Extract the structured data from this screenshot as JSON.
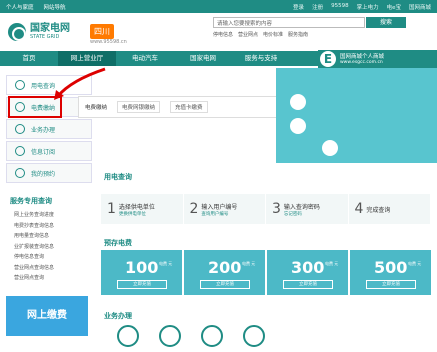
{
  "topbar": {
    "links": [
      "个人与家庭",
      "网站导航"
    ],
    "right": [
      "登录",
      "注册",
      "95598",
      "掌上电力",
      "电e宝",
      "国网商城",
      "95598"
    ]
  },
  "header": {
    "logo_cn": "国家电网",
    "logo_en": "STATE GRID",
    "province": "四川",
    "province_url": "www.95598.cn"
  },
  "search": {
    "placeholder": "请输入您要搜索的内容",
    "button": "搜索",
    "hot": [
      "停电信息",
      "营业网点",
      "电价标准",
      "服务指南"
    ]
  },
  "nav": {
    "items": [
      "首页",
      "网上营业厅",
      "电动汽车",
      "国家电网",
      "服务与支持"
    ],
    "active": 1
  },
  "mall": {
    "title": "国网商城个人商城",
    "url": "www.esgcc.com.cn"
  },
  "sidebar": {
    "items": [
      "用电查询",
      "电费缴纳",
      "业务办理",
      "信息订阅",
      "我的预约"
    ]
  },
  "popup": {
    "label": "电费缴纳",
    "options": [
      "电费网银缴纳",
      "充值卡缴费"
    ]
  },
  "query": {
    "title": "用电查询",
    "steps": [
      {
        "n": "1",
        "t": "选择供电单位",
        "s": "更换供电单位"
      },
      {
        "n": "2",
        "t": "输入用户编号",
        "s": "查询用户编号"
      },
      {
        "n": "3",
        "t": "输入查询密码",
        "s": "忘记密码"
      },
      {
        "n": "4",
        "t": "完成查询",
        "s": ""
      }
    ]
  },
  "prepay": {
    "title": "预存电费",
    "items": [
      {
        "amt": "100",
        "btn": "立即充值"
      },
      {
        "amt": "200",
        "btn": "立即充值"
      },
      {
        "amt": "300",
        "btn": "立即充值"
      },
      {
        "amt": "500",
        "btn": "立即充值"
      }
    ],
    "unit": "电费 元"
  },
  "biz": {
    "title": "业务办理"
  },
  "side2": {
    "title": "服务专用查询",
    "items": [
      "网上业务查询进度",
      "电费抄表查询信息",
      "用电量查询信息",
      "业扩报装查询信息",
      "停电信息查询",
      "营业网点查询信息",
      "营业网点查询"
    ]
  },
  "pay_banner": "网上缴费",
  "colors": {
    "brand": "#1f8c84",
    "highlight": "#d00000"
  }
}
